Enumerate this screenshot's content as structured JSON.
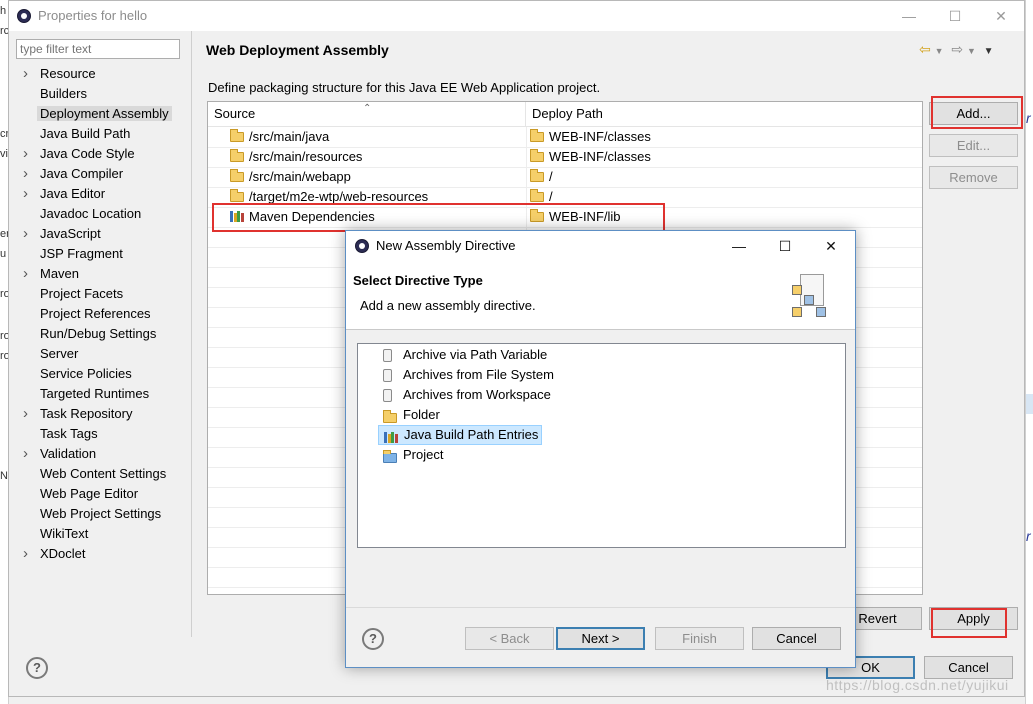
{
  "window": {
    "title": "Properties for hello"
  },
  "filter": {
    "placeholder": "type filter text"
  },
  "tree": [
    {
      "label": "Resource",
      "expandable": true
    },
    {
      "label": "Builders",
      "expandable": false
    },
    {
      "label": "Deployment Assembly",
      "expandable": false,
      "selected": true
    },
    {
      "label": "Java Build Path",
      "expandable": false
    },
    {
      "label": "Java Code Style",
      "expandable": true
    },
    {
      "label": "Java Compiler",
      "expandable": true
    },
    {
      "label": "Java Editor",
      "expandable": true
    },
    {
      "label": "Javadoc Location",
      "expandable": false
    },
    {
      "label": "JavaScript",
      "expandable": true
    },
    {
      "label": "JSP Fragment",
      "expandable": false
    },
    {
      "label": "Maven",
      "expandable": true
    },
    {
      "label": "Project Facets",
      "expandable": false
    },
    {
      "label": "Project References",
      "expandable": false
    },
    {
      "label": "Run/Debug Settings",
      "expandable": false
    },
    {
      "label": "Server",
      "expandable": false
    },
    {
      "label": "Service Policies",
      "expandable": false
    },
    {
      "label": "Targeted Runtimes",
      "expandable": false
    },
    {
      "label": "Task Repository",
      "expandable": true
    },
    {
      "label": "Task Tags",
      "expandable": false
    },
    {
      "label": "Validation",
      "expandable": true
    },
    {
      "label": "Web Content Settings",
      "expandable": false
    },
    {
      "label": "Web Page Editor",
      "expandable": false
    },
    {
      "label": "Web Project Settings",
      "expandable": false
    },
    {
      "label": "WikiText",
      "expandable": false
    },
    {
      "label": "XDoclet",
      "expandable": true
    }
  ],
  "page": {
    "title": "Web Deployment Assembly",
    "description": "Define packaging structure for this Java EE Web Application project.",
    "columns": {
      "source": "Source",
      "deploy": "Deploy Path"
    },
    "rows": [
      {
        "source": "/src/main/java",
        "deploy": "WEB-INF/classes",
        "icon": "folder-icon"
      },
      {
        "source": "/src/main/resources",
        "deploy": "WEB-INF/classes",
        "icon": "folder-icon"
      },
      {
        "source": "/src/main/webapp",
        "deploy": "/",
        "icon": "folder-icon"
      },
      {
        "source": "/target/m2e-wtp/web-resources",
        "deploy": "/",
        "icon": "folder-icon"
      },
      {
        "source": "Maven Dependencies",
        "deploy": "WEB-INF/lib",
        "icon": "library-icon"
      }
    ],
    "buttons": {
      "add": "Add...",
      "edit": "Edit...",
      "remove": "Remove",
      "revert": "Revert",
      "apply": "Apply"
    }
  },
  "footer": {
    "ok": "OK",
    "cancel": "Cancel",
    "watermark": "https://blog.csdn.net/yujikui"
  },
  "dialog": {
    "title": "New Assembly Directive",
    "heading": "Select Directive Type",
    "subheading": "Add a new assembly directive.",
    "items": [
      {
        "label": "Archive via Path Variable",
        "icon": "jar-icon"
      },
      {
        "label": "Archives from File System",
        "icon": "jar-icon"
      },
      {
        "label": "Archives from Workspace",
        "icon": "jar-icon"
      },
      {
        "label": "Folder",
        "icon": "folder-icon"
      },
      {
        "label": "Java Build Path Entries",
        "icon": "library-icon",
        "selected": true
      },
      {
        "label": "Project",
        "icon": "project-folder-icon"
      }
    ],
    "buttons": {
      "back": "< Back",
      "next": "Next >",
      "finish": "Finish",
      "cancel": "Cancel"
    }
  },
  "colors": {
    "highlight": "#e0322f",
    "selection": "#cce8ff",
    "accent": "#3c7fb1"
  }
}
